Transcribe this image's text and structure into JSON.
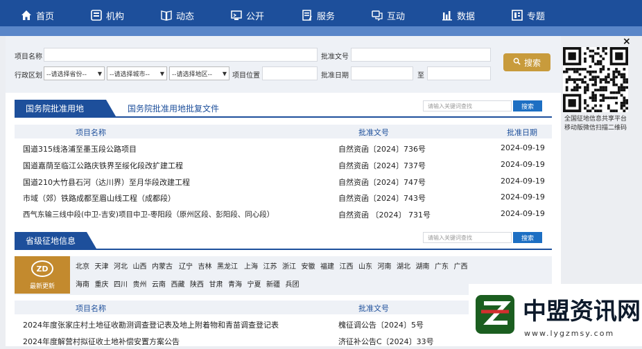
{
  "nav": {
    "items": [
      {
        "label": "首页",
        "icon": "home-icon"
      },
      {
        "label": "机构",
        "icon": "org-icon"
      },
      {
        "label": "动态",
        "icon": "news-icon"
      },
      {
        "label": "公开",
        "icon": "screen-icon"
      },
      {
        "label": "服务",
        "icon": "service-icon"
      },
      {
        "label": "互动",
        "icon": "chat-icon"
      },
      {
        "label": "数据",
        "icon": "bar-chart-icon"
      },
      {
        "label": "专题",
        "icon": "topic-icon"
      }
    ]
  },
  "search": {
    "project_name_label": "项目名称",
    "approval_no_label": "批准文号",
    "region_label": "行政区划",
    "province_select": "--请选择省份--",
    "city_select": "--请选择城市--",
    "district_select": "--请选择地区--",
    "location_label": "项目位置",
    "date_label": "批准日期",
    "date_to": "至",
    "button_label": "搜索"
  },
  "state_council": {
    "tab": "国务院批准用地",
    "link": "国务院批准用地批复文件",
    "search_placeholder": "请输入关键词查找",
    "search_button": "搜索",
    "columns": [
      "项目名称",
      "批准文号",
      "批准日期"
    ],
    "rows": [
      {
        "name": "国道315线洛浦至墨玉段公路项目",
        "no": "自然资函〔2024〕736号",
        "date": "2024-09-19"
      },
      {
        "name": "国道嘉荫至临江公路庆铁界至绥化段改扩建工程",
        "no": "自然资函〔2024〕737号",
        "date": "2024-09-19"
      },
      {
        "name": "国道210大竹县石河（达川界）至月华段改建工程",
        "no": "自然资函〔2024〕747号",
        "date": "2024-09-19"
      },
      {
        "name": "市域（郊）铁路成都至眉山线工程（成都段）",
        "no": "自然资函〔2024〕743号",
        "date": "2024-09-19"
      },
      {
        "name": "西气东输三线中段(中卫-吉安)项目中卫-枣阳段（原州区段、彭阳段、同心段）",
        "no": "自然资函 〔2024〕 731号",
        "date": "2024-09-19"
      }
    ]
  },
  "provincial": {
    "tab": "省级征地信息",
    "search_placeholder": "请输入关键词查找",
    "search_button": "搜索",
    "badge_logo": "ZD",
    "badge_text": "最新更新",
    "provinces_row1": [
      "北京",
      "天津",
      "河北",
      "山西",
      "内蒙古",
      "辽宁",
      "吉林",
      "黑龙江",
      "上海",
      "江苏",
      "浙江",
      "安徽",
      "福建",
      "江西",
      "山东",
      "河南",
      "湖北",
      "湖南",
      "广东",
      "广西"
    ],
    "provinces_row2": [
      "海南",
      "重庆",
      "四川",
      "贵州",
      "云南",
      "西藏",
      "陕西",
      "甘肃",
      "青海",
      "宁夏",
      "新疆",
      "兵团"
    ],
    "columns": [
      "项目名称",
      "批准文号"
    ],
    "rows": [
      {
        "name": "2024年度张家庄村土地征收勘测调查登记表及地上附着物和青苗调查登记表",
        "no": "槐征调公告〔2024〕5号"
      },
      {
        "name": "2024年度解营村拟征收土地补偿安置方案公告",
        "no": "济征补公告C〔2024〕33号"
      }
    ]
  },
  "qr": {
    "close": "×",
    "caption_line1": "全国征地信息共享平台",
    "caption_line2": "移动版微信扫描二维码"
  },
  "watermark": {
    "title": "中盟资讯网",
    "url": "www.lygzmsy.com"
  },
  "colors": {
    "nav": "#1d4f9b",
    "accent": "#c89b3c",
    "badge": "#c38a2e"
  }
}
